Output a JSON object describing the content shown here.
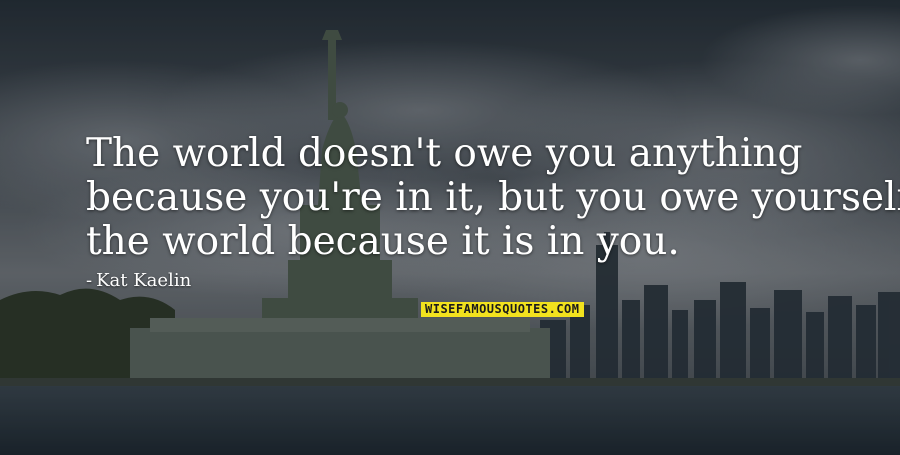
{
  "quote": {
    "lines": [
      "The world doesn't owe you anything",
      "because you're in it, but you owe yourself",
      "the world because it is in you."
    ],
    "author": "Kat Kaelin",
    "author_prefix": "-"
  },
  "watermark": {
    "text": "WISEFAMOUSQUOTES.COM"
  },
  "colors": {
    "sky_top": "#2e3942",
    "cloud": "#8a9098",
    "water": "#2a3640",
    "statue": "#4b5a4e",
    "watermark_bg": "#f2e21e",
    "text": "#ffffff"
  }
}
